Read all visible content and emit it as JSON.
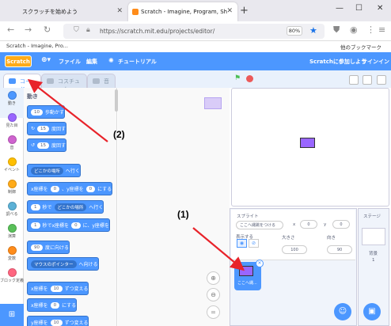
{
  "browser": {
    "tabs": [
      {
        "title": "スクラッチを始めよう"
      },
      {
        "title": "Scratch - Imagine, Program, Sh"
      }
    ],
    "url": "https://scratch.mit.edu/projects/editor/",
    "zoom": "80%",
    "bookmarks": [
      "Scratch - Imagine, Pro...",
      "他のブックマーク"
    ]
  },
  "menubar": {
    "logo": "Scratch",
    "file": "ファイル",
    "edit": "編集",
    "tutorial": "チュートリアル",
    "join": "Scratchに参加しよう",
    "signin": "サインイン"
  },
  "tabs": {
    "code": "コード",
    "costume": "コスチューム",
    "sound": "音"
  },
  "categories": [
    {
      "label": "動き",
      "color": "#4c97ff"
    },
    {
      "label": "見た目",
      "color": "#9966ff"
    },
    {
      "label": "音",
      "color": "#cf63cf"
    },
    {
      "label": "イベント",
      "color": "#ffbf00"
    },
    {
      "label": "制御",
      "color": "#ffab19"
    },
    {
      "label": "調べる",
      "color": "#5cb1d6"
    },
    {
      "label": "演算",
      "color": "#59c059"
    },
    {
      "label": "変数",
      "color": "#ff8c1a"
    },
    {
      "label": "ブロック定義",
      "color": "#ff6680"
    }
  ],
  "palette": {
    "heading": "動き",
    "b1_val": "10",
    "b1_txt": "歩動かす",
    "b2_val": "15",
    "b2_txt": "度回す",
    "b3_val": "15",
    "b3_txt": "度回す",
    "b4_drop": "どこかの場所",
    "b4_txt": "へ行く",
    "b5_a": "x座標を",
    "b5_x": "0",
    "b5_b": "、y座標を",
    "b5_y": "0",
    "b5_c": "にする",
    "b6_val": "1",
    "b6_a": "秒で",
    "b6_drop": "どこかの場所",
    "b6_b": "へ行く",
    "b7_val": "1",
    "b7_a": "秒でx座標を",
    "b7_x": "0",
    "b7_b": "に、y座標を",
    "b8_val": "90",
    "b8_txt": "度に向ける",
    "b9_drop": "マウスのポインター",
    "b9_txt": "へ向ける",
    "b10_a": "x座標を",
    "b10_val": "10",
    "b10_b": "ずつ変える",
    "b11_a": "x座標を",
    "b11_val": "0",
    "b11_b": "にする",
    "b12_a": "y座標を",
    "b12_val": "10",
    "b12_b": "ずつ変える"
  },
  "sprite": {
    "label": "スプライト",
    "name_placeholder": "ここへ縄跳をつける",
    "x_label": "x",
    "x": "0",
    "y_label": "y",
    "y": "0",
    "show_label": "表示する",
    "size_label": "大きさ",
    "size": "100",
    "direction_label": "向き",
    "direction": "90",
    "tile_name": "ここへ縄..."
  },
  "stagepane": {
    "label": "ステージ",
    "backdrops_label": "背景",
    "backdrops_count": "1"
  },
  "annotations": {
    "a1": "(1)",
    "a2": "(2)"
  },
  "colors": {
    "scratch_blue": "#4c97ff",
    "sprite_purple": "#9966ff",
    "annotation_red": "#e8232a"
  }
}
